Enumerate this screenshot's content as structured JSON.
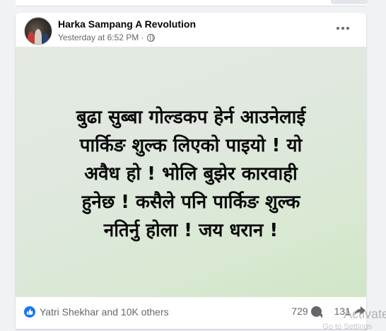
{
  "post": {
    "author": "Harka Sampang A Revolution",
    "timestamp": "Yesterday at 6:52 PM",
    "separator": "·",
    "privacy_icon": "globe-icon",
    "menu_icon": "more-options-icon",
    "text_lines": [
      "बुढा सुब्बा गोल्डकप हेर्न आउनेलाई",
      "पार्किङ शुल्क लिएको पाइयो ! यो",
      "अवैध हो ! भोलि बुझेर कारवाही",
      "हुनेछ ! कसैले पनि पार्किङ शुल्क",
      "नतिर्नु होला ! जय धरान !"
    ]
  },
  "footer": {
    "reactions_text": "Yatri Shekhar and 10K others",
    "comments_count": "729",
    "shares_count": "131"
  },
  "watermark": {
    "text": "Activate",
    "subtext": "Go to Settings"
  },
  "colors": {
    "like_blue": "#1877f2",
    "secondary_text": "#65676b",
    "card_bg": "#ffffff",
    "page_bg": "#f0f2f5"
  }
}
